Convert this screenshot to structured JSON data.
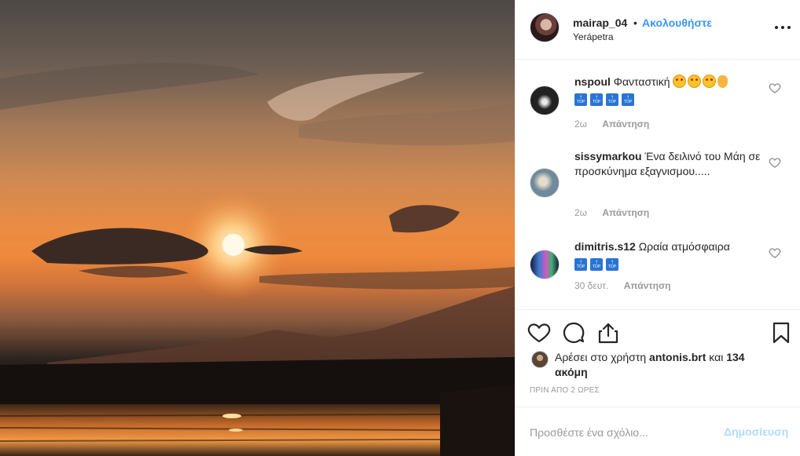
{
  "photo": {
    "alt_icon": "sunset-photo"
  },
  "header": {
    "username": "mairap_04",
    "separator": "•",
    "follow_label": "Ακολουθήστε",
    "location": "Yerápetra"
  },
  "comments": [
    {
      "user": "nspoul",
      "text": "Φανταστική",
      "emoji_count": 3,
      "top_count": 4,
      "time": "2ω",
      "reply_label": "Απάντηση"
    },
    {
      "user": "sissymarkou",
      "text": "Ένα δειλινό του Μάη σε προσκύνημα εξαγνισμου.....",
      "time": "2ω",
      "reply_label": "Απάντηση"
    },
    {
      "user": "dimitris.s12",
      "text": "Ωραία ατμόσφαιρα",
      "top_count": 3,
      "time": "30 δευτ.",
      "reply_label": "Απάντηση"
    }
  ],
  "top_badge": {
    "arrow": "↑",
    "text": "TOP"
  },
  "likes": {
    "prefix": "Αρέσει στο χρήστη",
    "user": "antonis.brt",
    "conjunction": "και",
    "count_text": "134 ακόμη"
  },
  "timestamp": "ΠΡΙΝ ΑΠΟ 2 ΩΡΕΣ",
  "add_comment": {
    "placeholder": "Προσθέστε ένα σχόλιο...",
    "post_label": "Δημοσίευση"
  },
  "colors": {
    "link_blue": "#3897f0",
    "post_disabled": "#b3dbff",
    "muted": "#999999",
    "text": "#262626"
  }
}
